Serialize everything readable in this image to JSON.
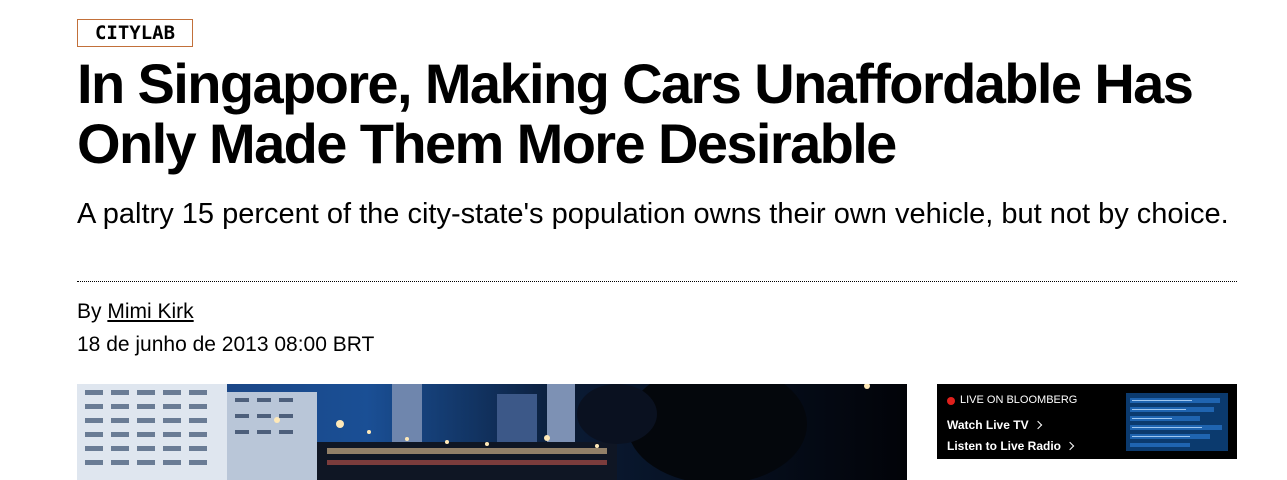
{
  "brand": {
    "logo_text": "CITYLAB"
  },
  "article": {
    "headline": "In Singapore, Making Cars Unaffordable Has Only Made Them More Desirable",
    "dek": "A paltry 15 percent of the city-state's population owns their own vehicle, but not by choice.",
    "byline_prefix": "By",
    "author": "Mimi Kirk",
    "date": "18 de junho de 2013 08:00 BRT"
  },
  "live": {
    "label": "LIVE ON BLOOMBERG",
    "watch": "Watch Live TV",
    "listen": "Listen to Live Radio"
  },
  "colors": {
    "logo_border": "#c2703a",
    "live_dot": "#e0201c",
    "live_bg": "#000000",
    "thumb_bg": "#0b3a6e"
  },
  "icons": {
    "live": "live-dot-icon",
    "chevron": "chevron-right-icon"
  }
}
